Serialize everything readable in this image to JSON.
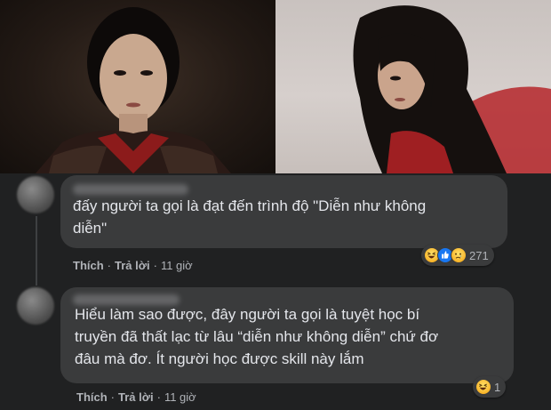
{
  "comments": [
    {
      "text": "đấy người ta gọi là đạt đến trình độ \"Diễn như không\ndiễn\"",
      "actions": {
        "like": "Thích",
        "reply": "Trả lời",
        "time": "11 giờ",
        "separator": "·"
      },
      "reactions": {
        "icons": [
          "haha-icon",
          "like-icon",
          "sad-icon"
        ],
        "count": "271"
      }
    },
    {
      "text": "Hiểu làm sao được, đây người ta gọi là tuyệt học bí\ntruyền đã thất lạc từ lâu “diễn như không diễn” chứ đơ\nđâu mà đơ. Ít người học được skill này lắm",
      "actions": {
        "like": "Thích",
        "reply": "Trả lời",
        "time": "11 giờ",
        "separator": "·"
      },
      "reactions": {
        "icons": [
          "haha-icon"
        ],
        "count": "1"
      }
    }
  ],
  "colors": {
    "background": "#18191a",
    "bubble": "#3a3b3c",
    "text": "#e4e6eb",
    "secondary_text": "#b0b3b8",
    "like_blue": "#1877f2",
    "haha_yellow": "#f7b125"
  }
}
